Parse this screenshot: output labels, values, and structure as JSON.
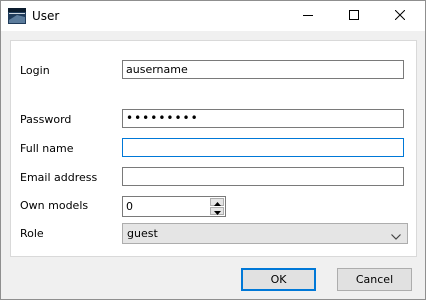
{
  "window": {
    "title": "User",
    "app_icon": "window-icon",
    "controls": {
      "minimize_icon": "minimize-icon",
      "maximize_icon": "maximize-icon",
      "close_icon": "close-icon"
    }
  },
  "form": {
    "login": {
      "label": "Login",
      "value": "ausername"
    },
    "password": {
      "label": "Password",
      "value": "•••••••••"
    },
    "full_name": {
      "label": "Full name",
      "value": ""
    },
    "email": {
      "label": "Email address",
      "value": ""
    },
    "own_models": {
      "label": "Own models",
      "value": "0"
    },
    "role": {
      "label": "Role",
      "value": "guest"
    }
  },
  "buttons": {
    "ok": "OK",
    "cancel": "Cancel"
  },
  "colors": {
    "focus_border": "#0078d7",
    "dialog_bg": "#f0f0f0"
  }
}
